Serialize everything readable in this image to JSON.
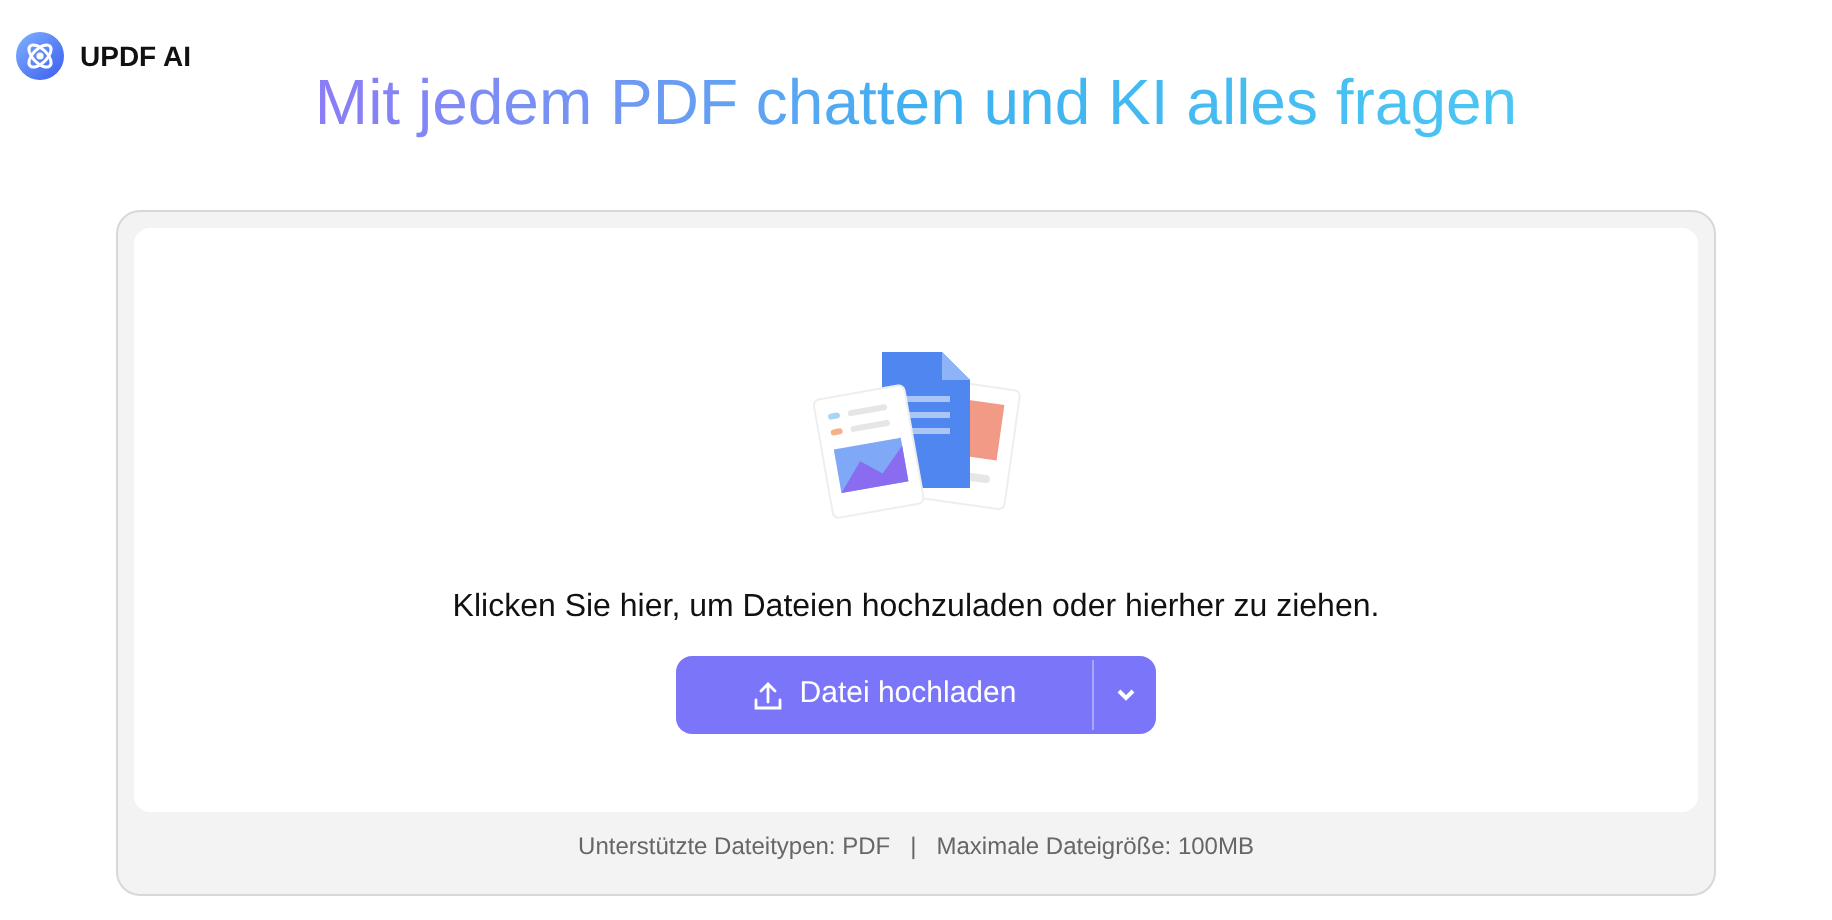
{
  "brand": {
    "name": "UPDF AI"
  },
  "heading": "Mit jedem PDF chatten und KI alles fragen",
  "upload": {
    "prompt": "Klicken Sie hier, um Dateien hochzuladen oder hierher zu ziehen.",
    "button": "Datei hochladen"
  },
  "footer": [
    "Unterstützte Dateitypen: PDF",
    "|",
    "Maximale Dateigröße: 100MB"
  ]
}
